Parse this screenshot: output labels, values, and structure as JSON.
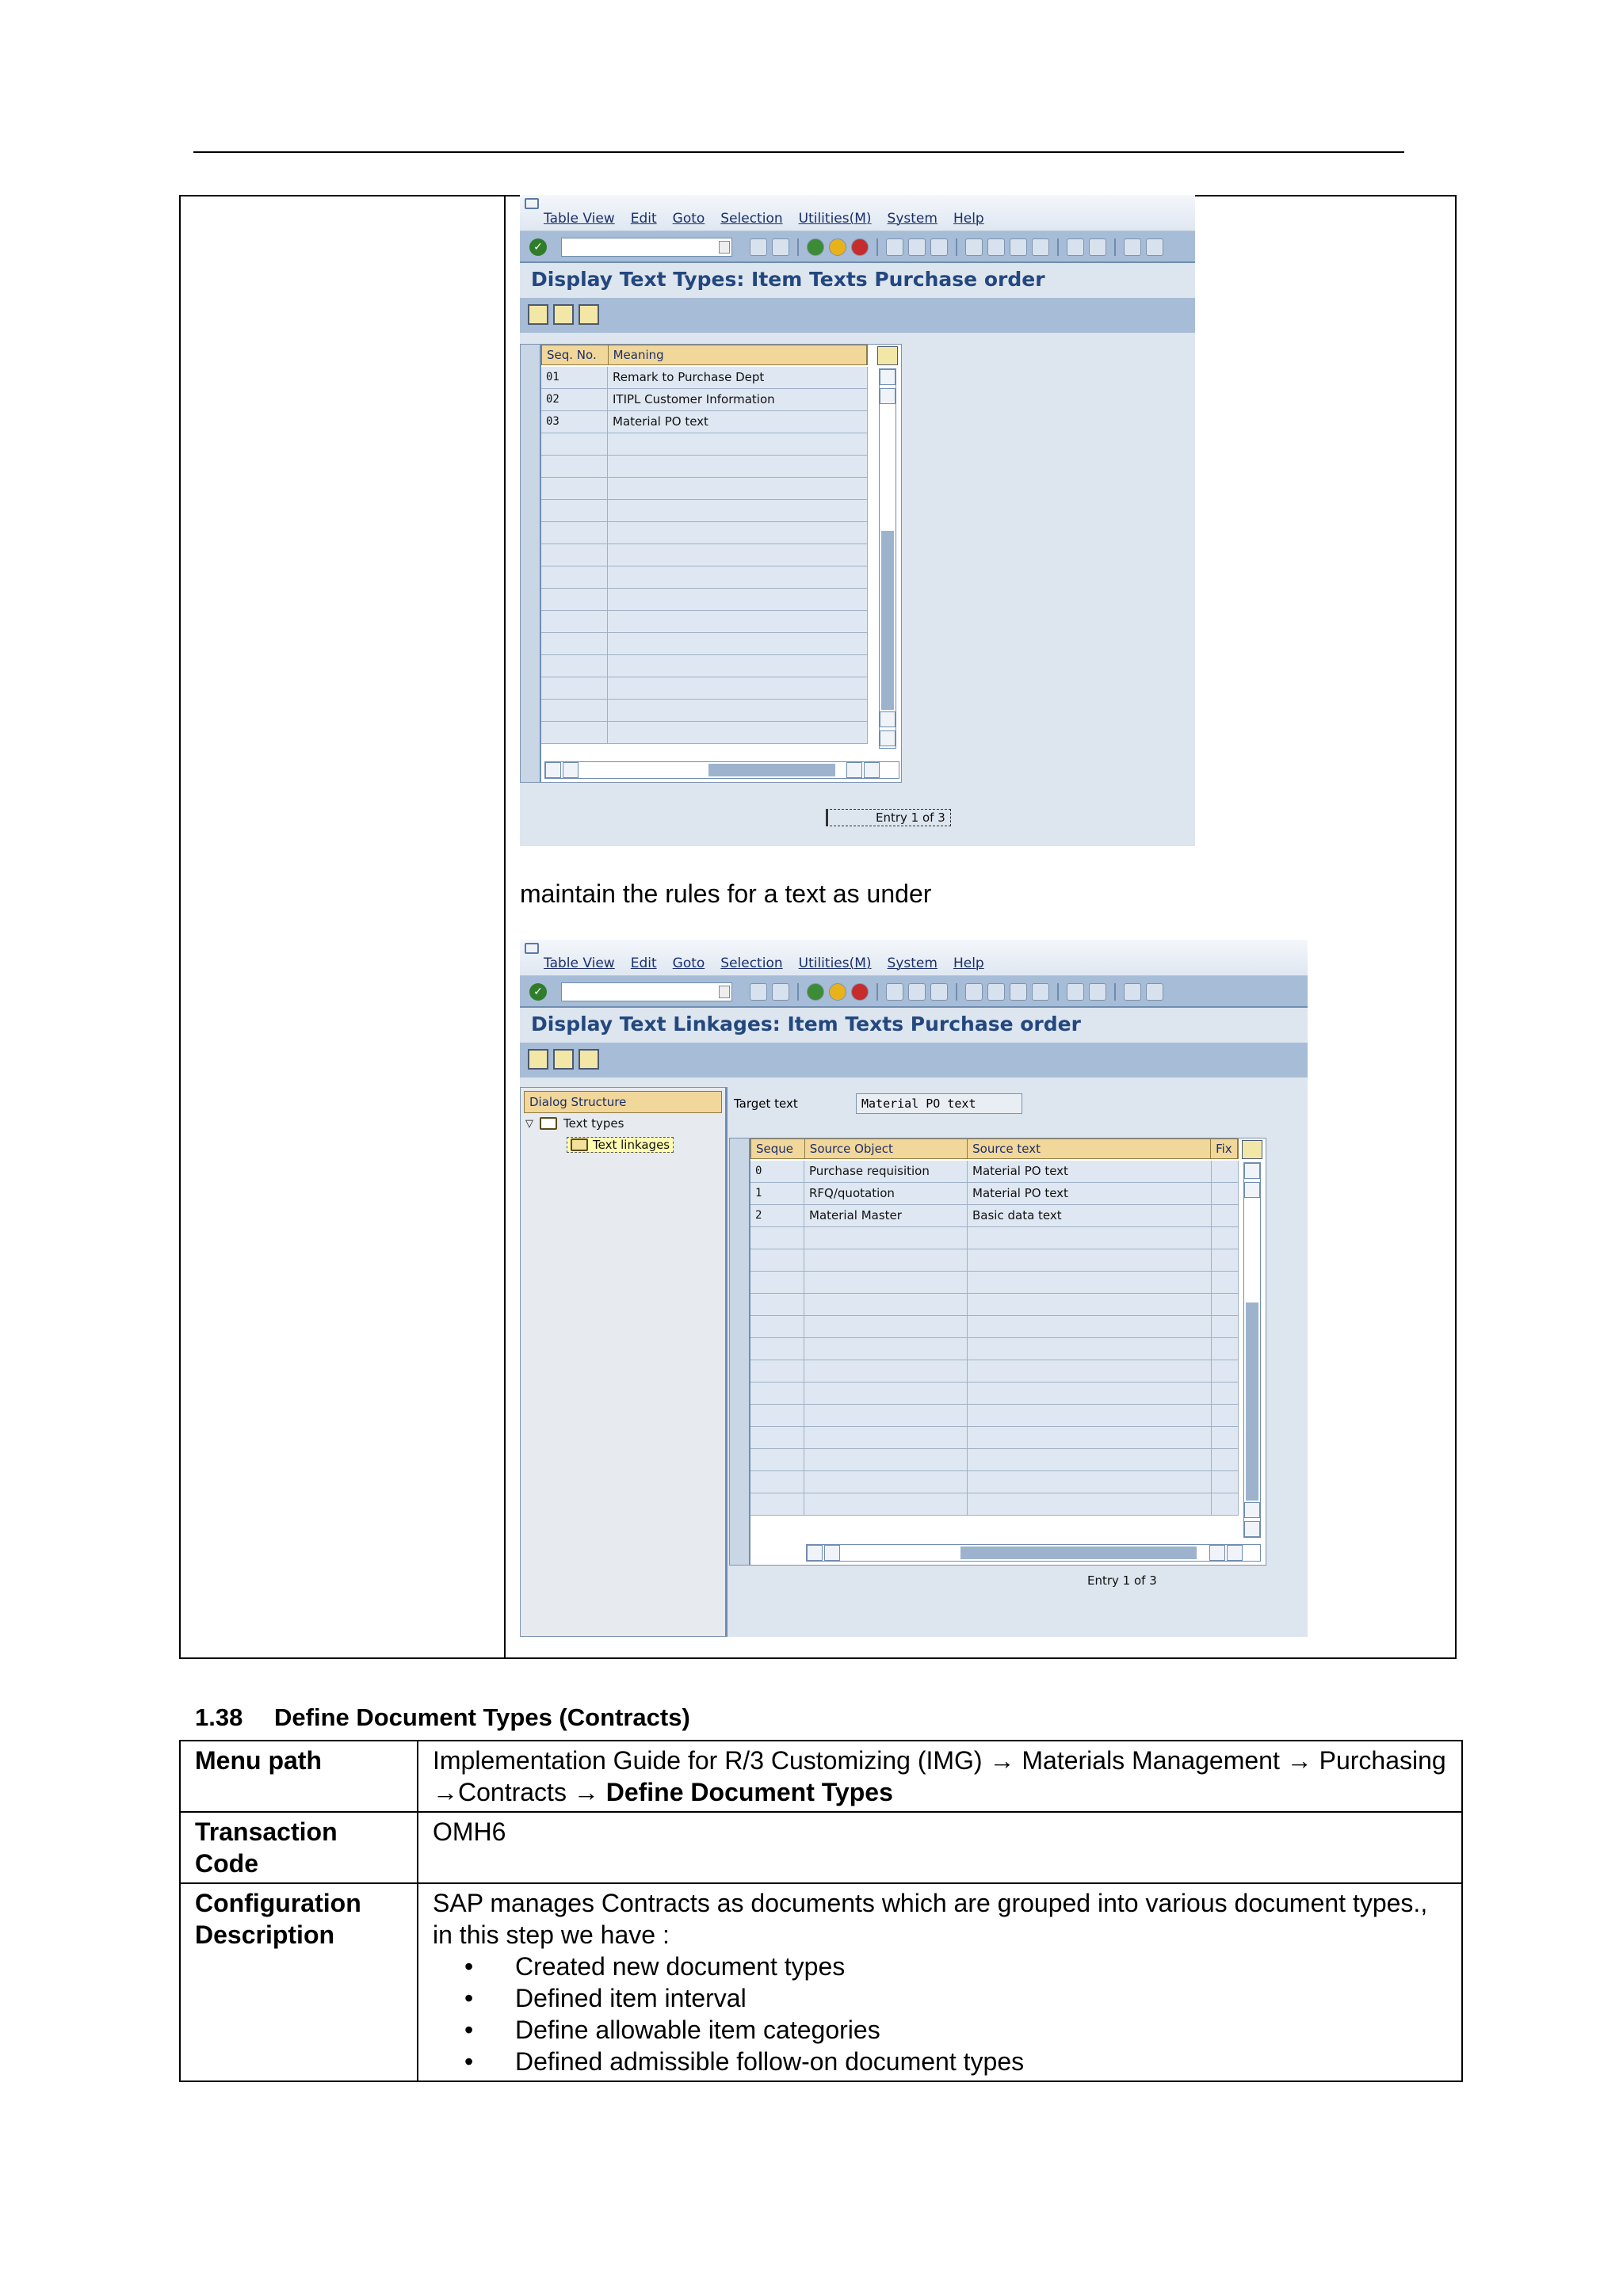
{
  "sap_menu": [
    "Table View",
    "Edit",
    "Goto",
    "Selection",
    "Utilities(M)",
    "System",
    "Help"
  ],
  "screen1": {
    "title": "Display Text Types: Item Texts Purchase order",
    "columns": [
      "Seq. No.",
      "Meaning"
    ],
    "rows": [
      {
        "seq": "01",
        "meaning": "Remark to Purchase Dept"
      },
      {
        "seq": "02",
        "meaning": "ITIPL Customer Information"
      },
      {
        "seq": "03",
        "meaning": "Material PO text"
      }
    ],
    "entry": "Entry 1 of 3"
  },
  "caption": "maintain the rules for a text as under",
  "screen2": {
    "title": "Display Text Linkages: Item Texts Purchase order",
    "dialog_header": "Dialog Structure",
    "tree_node1": "Text types",
    "tree_node2": "Text linkages",
    "target_label": "Target text",
    "target_value": "Material PO text",
    "columns": [
      "Seque",
      "Source Object",
      "Source text",
      "Fix"
    ],
    "rows": [
      {
        "seq": "0",
        "object": "Purchase requisition",
        "text": "Material PO text"
      },
      {
        "seq": "1",
        "object": "RFQ/quotation",
        "text": "Material PO text"
      },
      {
        "seq": "2",
        "object": "Material Master",
        "text": "Basic data text"
      }
    ],
    "entry": "Entry 1 of 3"
  },
  "section": {
    "number": "1.38",
    "title": "Define Document Types (Contracts)",
    "menu_path_label": "Menu path",
    "menu_path_text": "Implementation Guide for R/3 Customizing (IMG) → Materials Management → Purchasing →Contracts → ",
    "menu_path_bold": "Define Document Types",
    "tcode_label": "Transaction Code",
    "tcode_value": "OMH6",
    "config_label": "Configuration Description",
    "config_intro": "SAP manages Contracts as documents which are grouped into various document types., in this step we have :",
    "bullets": [
      "Created new document types",
      "Defined item interval",
      "Define allowable item categories",
      "Defined admissible follow-on document types"
    ]
  }
}
